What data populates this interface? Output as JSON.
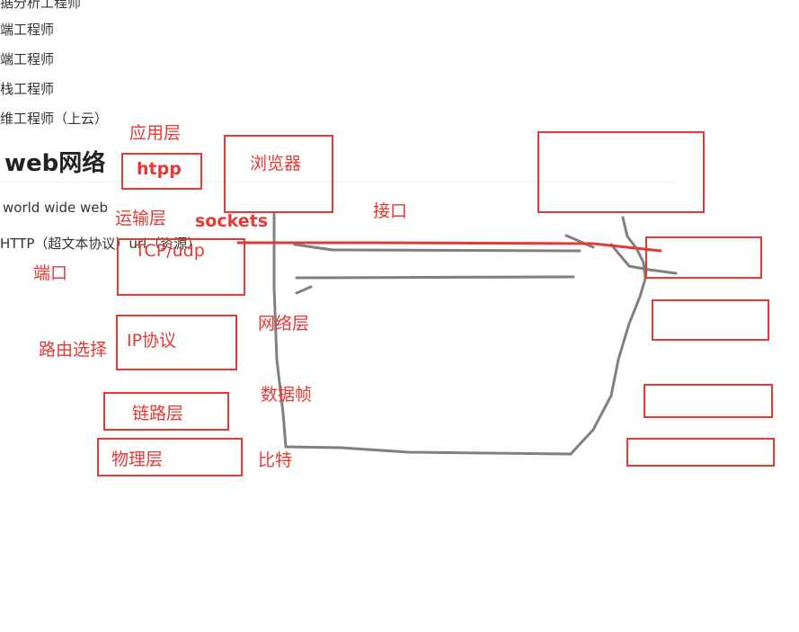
{
  "doc": {
    "lines": [
      "据分析工程师",
      "端工程师",
      "端工程师",
      "栈工程师",
      "维工程师（上云）"
    ],
    "heading": "web网络",
    "www": "world wide web",
    "http_line": "HTTP（超文本协议）url（资源）"
  },
  "annotations": {
    "app_layer": "应用层",
    "http": "htpp",
    "browser": "浏览器",
    "interface": "接口",
    "transport_layer": "运输层",
    "sockets": "sockets",
    "tcp": "TCP/udp",
    "port": "端口",
    "network_layer": "网络层",
    "ip": "IP协议",
    "routing": "路由选择",
    "frame": "数据帧",
    "link_layer": "链路层",
    "physical_layer": "物理层",
    "bit": "比特"
  },
  "colors": {
    "annotation": "#e53935",
    "sketch": "#808080"
  }
}
